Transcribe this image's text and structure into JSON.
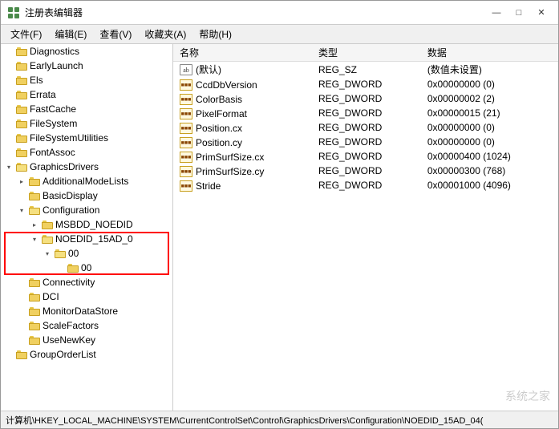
{
  "window": {
    "title": "注册表编辑器",
    "controls": {
      "minimize": "—",
      "maximize": "□",
      "close": "✕"
    }
  },
  "menu": {
    "items": [
      "文件(F)",
      "编辑(E)",
      "查看(V)",
      "收藏夹(A)",
      "帮助(H)"
    ]
  },
  "tree": {
    "items": [
      {
        "id": "diagnostics",
        "label": "Diagnostics",
        "level": 1,
        "hasChildren": false,
        "expanded": false,
        "selected": false
      },
      {
        "id": "earlylaunch",
        "label": "EarlyLaunch",
        "level": 1,
        "hasChildren": false,
        "expanded": false,
        "selected": false
      },
      {
        "id": "els",
        "label": "Els",
        "level": 1,
        "hasChildren": false,
        "expanded": false,
        "selected": false
      },
      {
        "id": "errata",
        "label": "Errata",
        "level": 1,
        "hasChildren": false,
        "expanded": false,
        "selected": false
      },
      {
        "id": "fastcache",
        "label": "FastCache",
        "level": 1,
        "hasChildren": false,
        "expanded": false,
        "selected": false
      },
      {
        "id": "filesystem",
        "label": "FileSystem",
        "level": 1,
        "hasChildren": false,
        "expanded": false,
        "selected": false
      },
      {
        "id": "filesystemutilities",
        "label": "FileSystemUtilities",
        "level": 1,
        "hasChildren": false,
        "expanded": false,
        "selected": false
      },
      {
        "id": "fontassoc",
        "label": "FontAssoc",
        "level": 1,
        "hasChildren": false,
        "expanded": false,
        "selected": false
      },
      {
        "id": "graphicsdrivers",
        "label": "GraphicsDrivers",
        "level": 1,
        "hasChildren": true,
        "expanded": true,
        "selected": false
      },
      {
        "id": "additionalmodelists",
        "label": "AdditionalModeLists",
        "level": 2,
        "hasChildren": true,
        "expanded": false,
        "selected": false
      },
      {
        "id": "basicdisplay",
        "label": "BasicDisplay",
        "level": 2,
        "hasChildren": false,
        "expanded": false,
        "selected": false
      },
      {
        "id": "configuration",
        "label": "Configuration",
        "level": 2,
        "hasChildren": true,
        "expanded": true,
        "selected": false
      },
      {
        "id": "msbdd_noedid",
        "label": "MSBDD_NOEDID",
        "level": 3,
        "hasChildren": true,
        "expanded": false,
        "selected": false
      },
      {
        "id": "noedid_15ad_0",
        "label": "NOEDID_15AD_0",
        "level": 3,
        "hasChildren": true,
        "expanded": true,
        "selected": false,
        "highlighted": true
      },
      {
        "id": "00",
        "label": "00",
        "level": 4,
        "hasChildren": true,
        "expanded": true,
        "selected": false,
        "highlighted": true
      },
      {
        "id": "00_child",
        "label": "00",
        "level": 5,
        "hasChildren": false,
        "expanded": false,
        "selected": false,
        "highlighted": true
      },
      {
        "id": "connectivity",
        "label": "Connectivity",
        "level": 2,
        "hasChildren": false,
        "expanded": false,
        "selected": false
      },
      {
        "id": "dci",
        "label": "DCI",
        "level": 2,
        "hasChildren": false,
        "expanded": false,
        "selected": false
      },
      {
        "id": "monitordatastore",
        "label": "MonitorDataStore",
        "level": 2,
        "hasChildren": false,
        "expanded": false,
        "selected": false
      },
      {
        "id": "scalefactors",
        "label": "ScaleFactors",
        "level": 2,
        "hasChildren": false,
        "expanded": false,
        "selected": false
      },
      {
        "id": "usenewkey",
        "label": "UseNewKey",
        "level": 2,
        "hasChildren": false,
        "expanded": false,
        "selected": false
      },
      {
        "id": "grouporderlist",
        "label": "GroupOrderList",
        "level": 1,
        "hasChildren": false,
        "expanded": false,
        "selected": false
      }
    ]
  },
  "registry_table": {
    "columns": [
      "名称",
      "类型",
      "数据"
    ],
    "rows": [
      {
        "name": "(默认)",
        "type": "REG_SZ",
        "data": "(数值未设置)",
        "icon": "ab"
      },
      {
        "name": "CcdDbVersion",
        "type": "REG_DWORD",
        "data": "0x00000000 (0)",
        "icon": "reg"
      },
      {
        "name": "ColorBasis",
        "type": "REG_DWORD",
        "data": "0x00000002 (2)",
        "icon": "reg"
      },
      {
        "name": "PixelFormat",
        "type": "REG_DWORD",
        "data": "0x00000015 (21)",
        "icon": "reg"
      },
      {
        "name": "Position.cx",
        "type": "REG_DWORD",
        "data": "0x00000000 (0)",
        "icon": "reg"
      },
      {
        "name": "Position.cy",
        "type": "REG_DWORD",
        "data": "0x00000000 (0)",
        "icon": "reg"
      },
      {
        "name": "PrimSurfSize.cx",
        "type": "REG_DWORD",
        "data": "0x00000400 (1024)",
        "icon": "reg"
      },
      {
        "name": "PrimSurfSize.cy",
        "type": "REG_DWORD",
        "data": "0x00000300 (768)",
        "icon": "reg"
      },
      {
        "name": "Stride",
        "type": "REG_DWORD",
        "data": "0x00001000 (4096)",
        "icon": "reg"
      }
    ]
  },
  "status_bar": {
    "text": "计算机\\HKEY_LOCAL_MACHINE\\SYSTEM\\CurrentControlSet\\Control\\GraphicsDrivers\\Configuration\\NOEDID_15AD_04("
  },
  "watermark": "系统之家"
}
